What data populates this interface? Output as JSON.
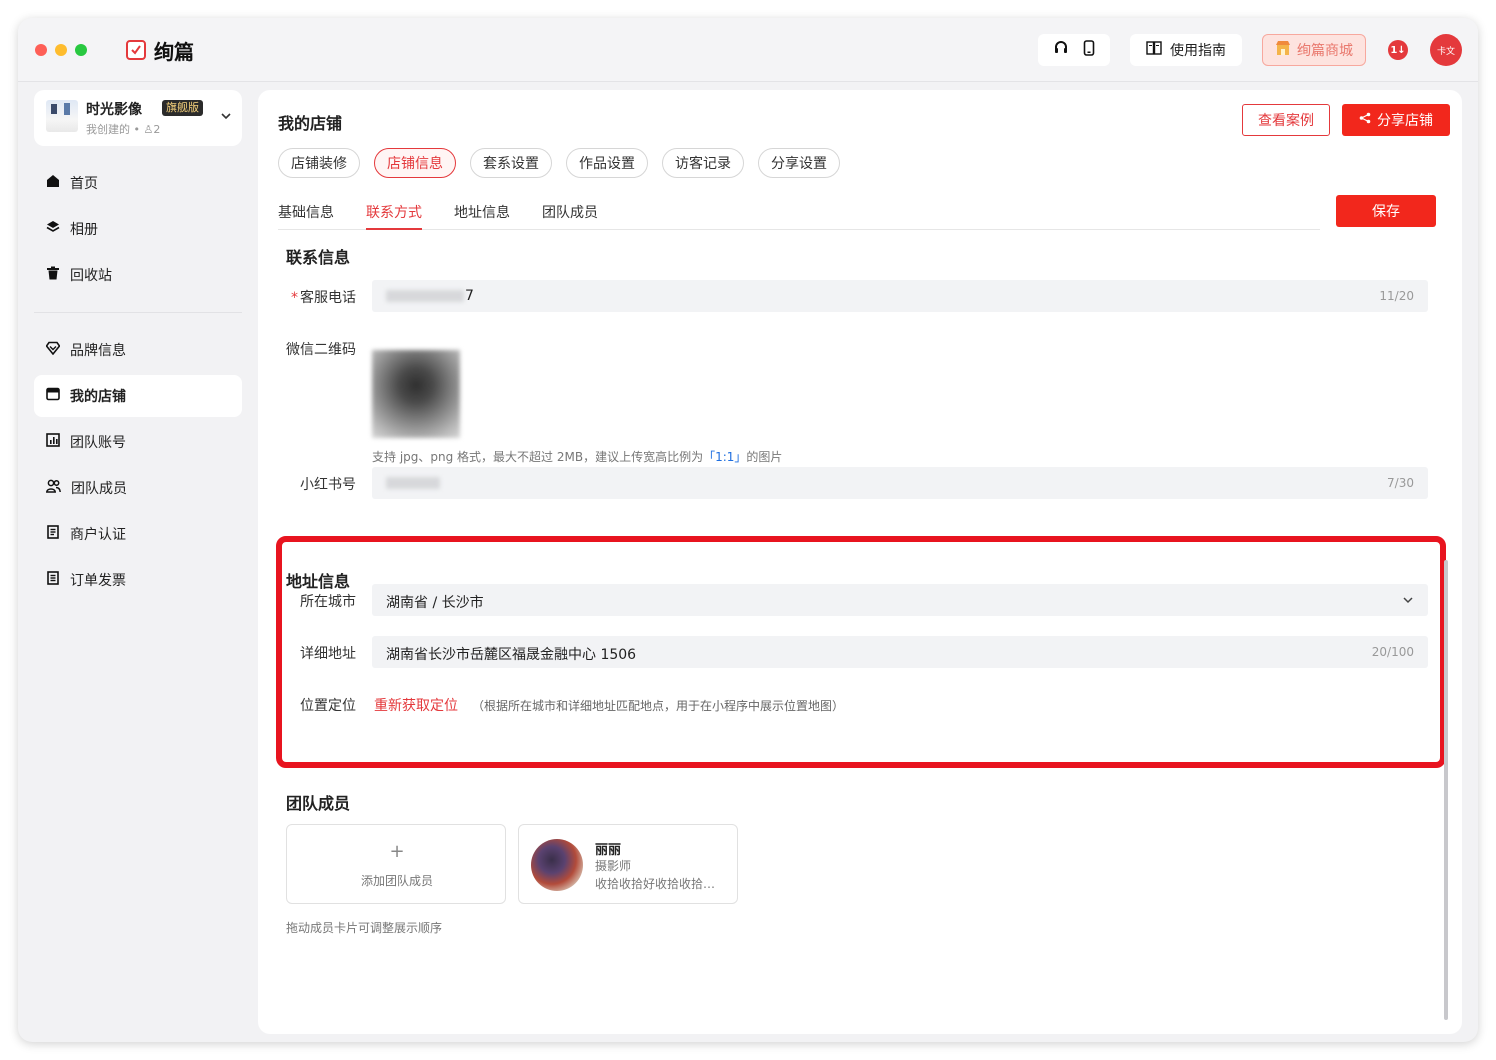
{
  "app": {
    "name": "绚篇",
    "guide_label": "使用指南",
    "mall_label": "绚篇商城",
    "notify_badge": "1↓",
    "avatar_text": "卡文",
    "colors": {
      "brand": "#e4393c",
      "primary_button": "#f2271c",
      "link_blue": "#1f6fe0"
    }
  },
  "sidebar": {
    "store": {
      "name": "时光影像",
      "badge": "旗舰版",
      "sub": "我创建的 • ♙2"
    },
    "items_top": [
      {
        "label": "首页",
        "icon": "home-icon"
      },
      {
        "label": "相册",
        "icon": "layers-icon"
      },
      {
        "label": "回收站",
        "icon": "trash-icon"
      }
    ],
    "items_bottom": [
      {
        "label": "品牌信息",
        "icon": "diamond-icon"
      },
      {
        "label": "我的店铺",
        "icon": "store-icon",
        "active": true
      },
      {
        "label": "团队账号",
        "icon": "chart-icon"
      },
      {
        "label": "团队成员",
        "icon": "users-icon"
      },
      {
        "label": "商户认证",
        "icon": "document-icon"
      },
      {
        "label": "订单发票",
        "icon": "invoice-icon"
      }
    ]
  },
  "main": {
    "title": "我的店铺",
    "view_cases_label": "查看案例",
    "share_label": "分享店铺",
    "save_label": "保存",
    "pills": [
      "店铺装修",
      "店铺信息",
      "套系设置",
      "作品设置",
      "访客记录",
      "分享设置"
    ],
    "active_pill": 1,
    "subtabs": [
      "基础信息",
      "联系方式",
      "地址信息",
      "团队成员"
    ],
    "active_subtab": 1
  },
  "contact": {
    "title": "联系信息",
    "phone_label": "客服电话",
    "phone_value_visible": "7",
    "phone_count": "11/20",
    "wechat_label": "微信二维码",
    "wechat_hint_pre": "支持 jpg、png 格式，最大不超过 2MB，建议上传宽高比例为",
    "wechat_hint_ratio": "「1:1」",
    "wechat_hint_post": "的图片",
    "xhs_label": "小红书号",
    "xhs_count": "7/30"
  },
  "address": {
    "title": "地址信息",
    "city_label": "所在城市",
    "city_value": "湖南省 / 长沙市",
    "detail_label": "详细地址",
    "detail_value": "湖南省长沙市岳麓区福晟金融中心 1506",
    "detail_count": "20/100",
    "location_label": "位置定位",
    "relocate_label": "重新获取定位",
    "relocate_hint": "（根据所在城市和详细地址匹配地点，用于在小程序中展示位置地图）"
  },
  "team": {
    "title": "团队成员",
    "add_plus": "+",
    "add_label": "添加团队成员",
    "member": {
      "name": "丽丽",
      "role": "摄影师",
      "bio": "收拾收拾好收拾收拾好收拾"
    },
    "drag_hint": "拖动成员卡片可调整展示顺序"
  }
}
